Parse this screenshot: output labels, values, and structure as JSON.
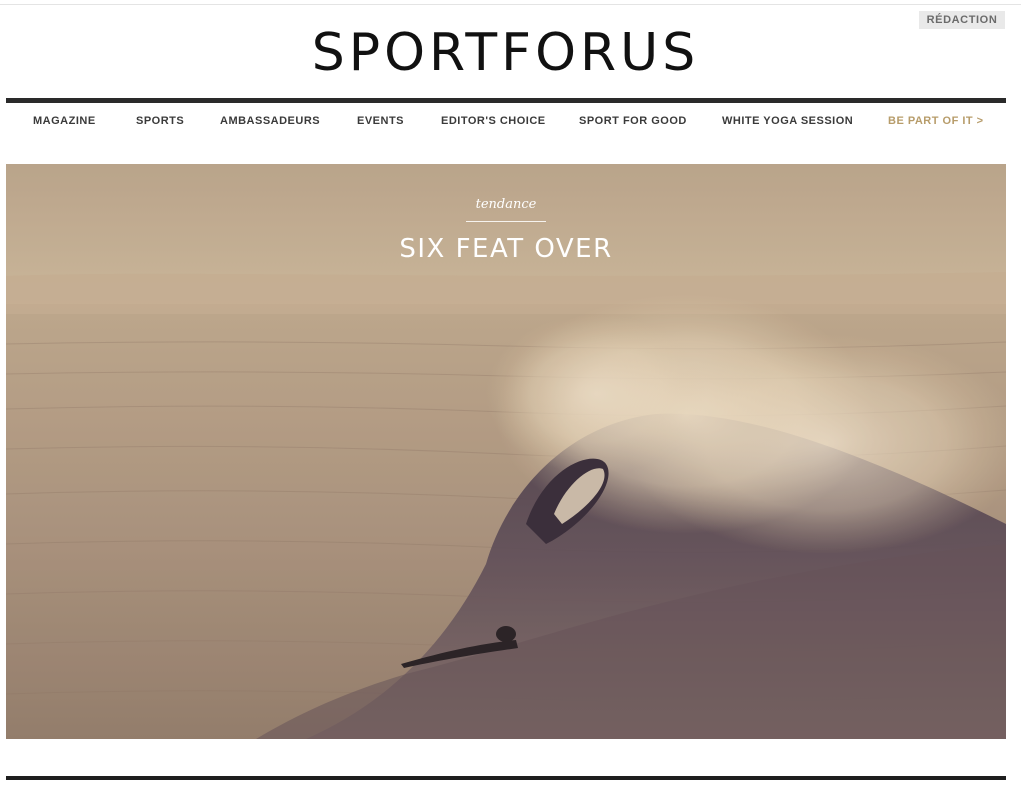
{
  "header": {
    "redaction_label": "RÉDACTION",
    "logo": "SPORTFORUS"
  },
  "nav": {
    "items": [
      {
        "label": "MAGAZINE"
      },
      {
        "label": "SPORTS"
      },
      {
        "label": "AMBASSADEURS"
      },
      {
        "label": "EVENTS"
      },
      {
        "label": "EDITOR'S CHOICE"
      },
      {
        "label": "SPORT FOR GOOD"
      },
      {
        "label": "WHITE YOGA SESSION"
      },
      {
        "label": "BE PART OF IT >"
      }
    ],
    "accent_color": "#b79c6a"
  },
  "hero": {
    "kicker": "tendance",
    "headline": "SIX FEAT OVER",
    "image": "surf-wave-photo"
  }
}
